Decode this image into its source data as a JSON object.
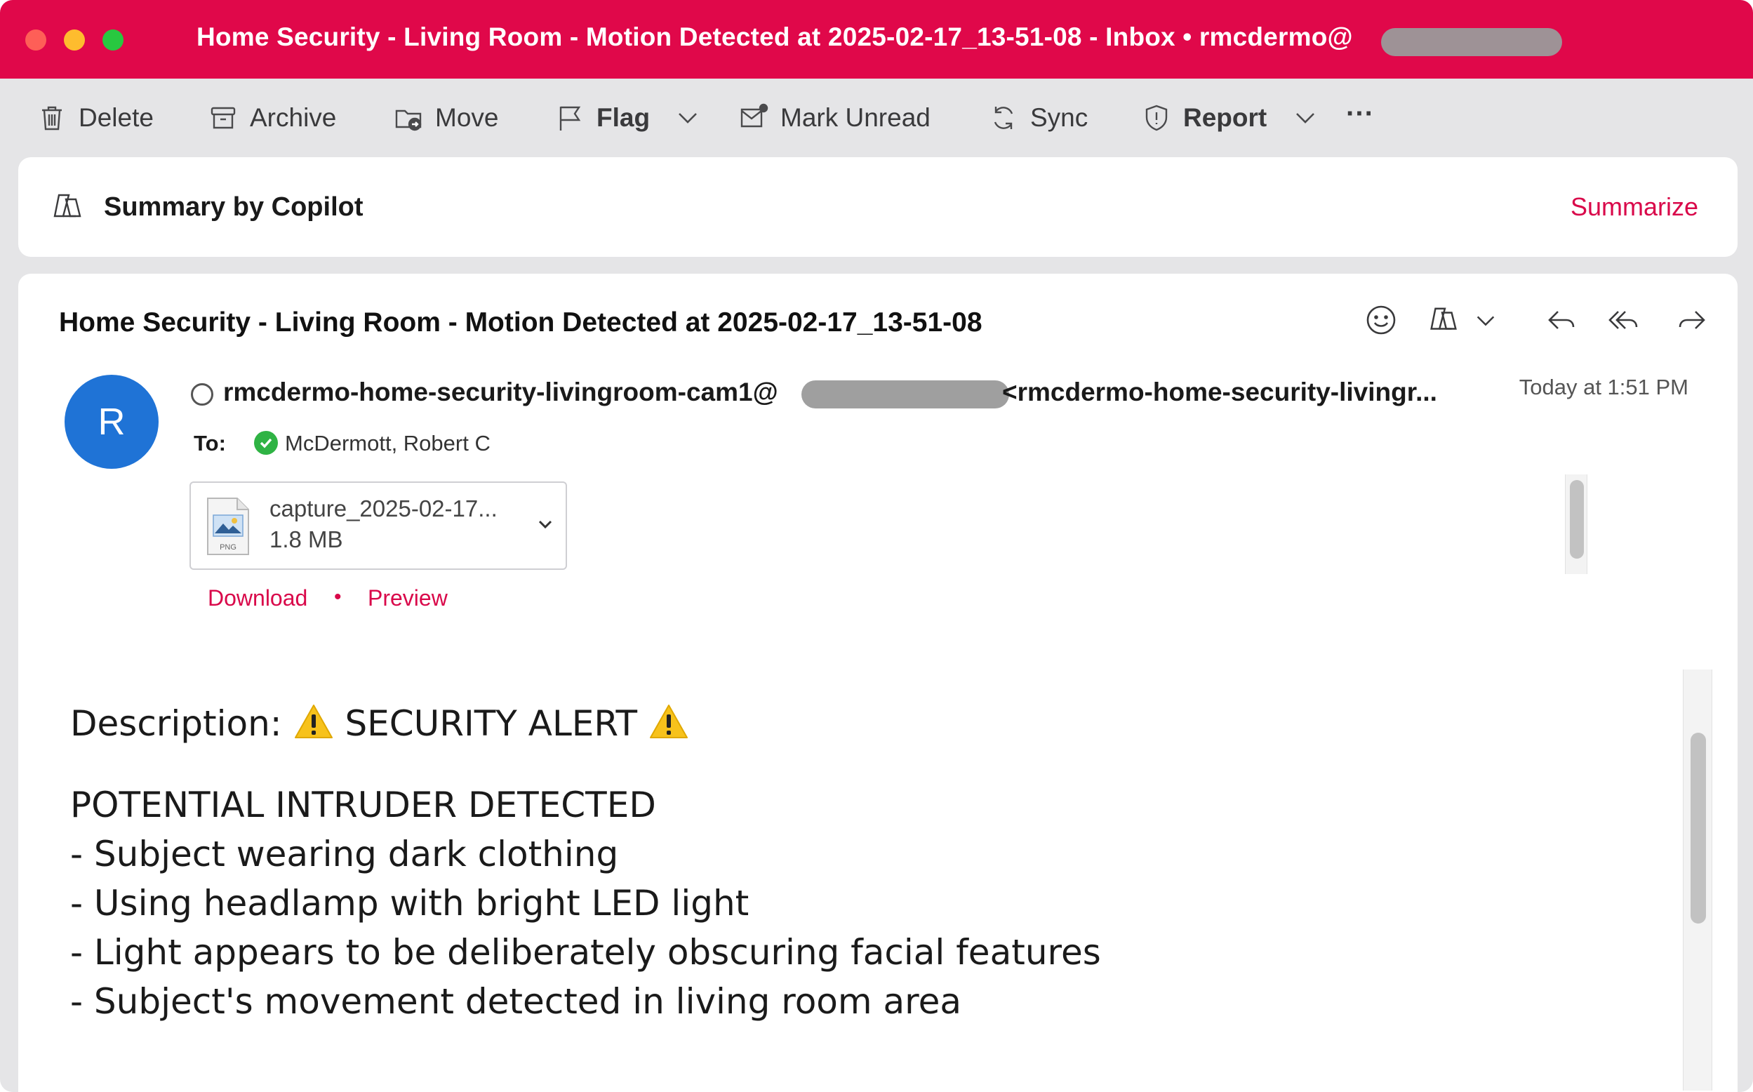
{
  "window": {
    "title": "Home Security - Living Room - Motion Detected at 2025-02-17_13-51-08 - Inbox • rmcdermo@",
    "accent_color": "#e0084a"
  },
  "toolbar": {
    "delete_label": "Delete",
    "archive_label": "Archive",
    "move_label": "Move",
    "flag_label": "Flag",
    "mark_unread_label": "Mark Unread",
    "sync_label": "Sync",
    "report_label": "Report",
    "more_label": "···"
  },
  "copilot": {
    "label": "Summary by Copilot",
    "summarize_label": "Summarize"
  },
  "message": {
    "subject": "Home Security - Living Room - Motion Detected at 2025-02-17_13-51-08",
    "avatar_initial": "R",
    "sender_address": "rmcdermo-home-security-livingroom-cam1@",
    "sender_display": "<rmcdermo-home-security-livingr...",
    "timestamp": "Today at 1:51 PM",
    "to_label": "To:",
    "recipient": "McDermott, Robert C",
    "attachment": {
      "name": "capture_2025-02-17...",
      "size": "1.8 MB",
      "type_label": "PNG"
    },
    "download_label": "Download",
    "separator": "•",
    "preview_label": "Preview",
    "body": {
      "description_prefix": "Description:",
      "alert_text": "SECURITY ALERT",
      "heading": "POTENTIAL INTRUDER DETECTED",
      "bullets": [
        "- Subject wearing dark clothing",
        "- Using headlamp with bright LED light",
        "- Light appears to be deliberately obscuring facial features",
        "- Subject's movement detected in living room area"
      ]
    }
  }
}
